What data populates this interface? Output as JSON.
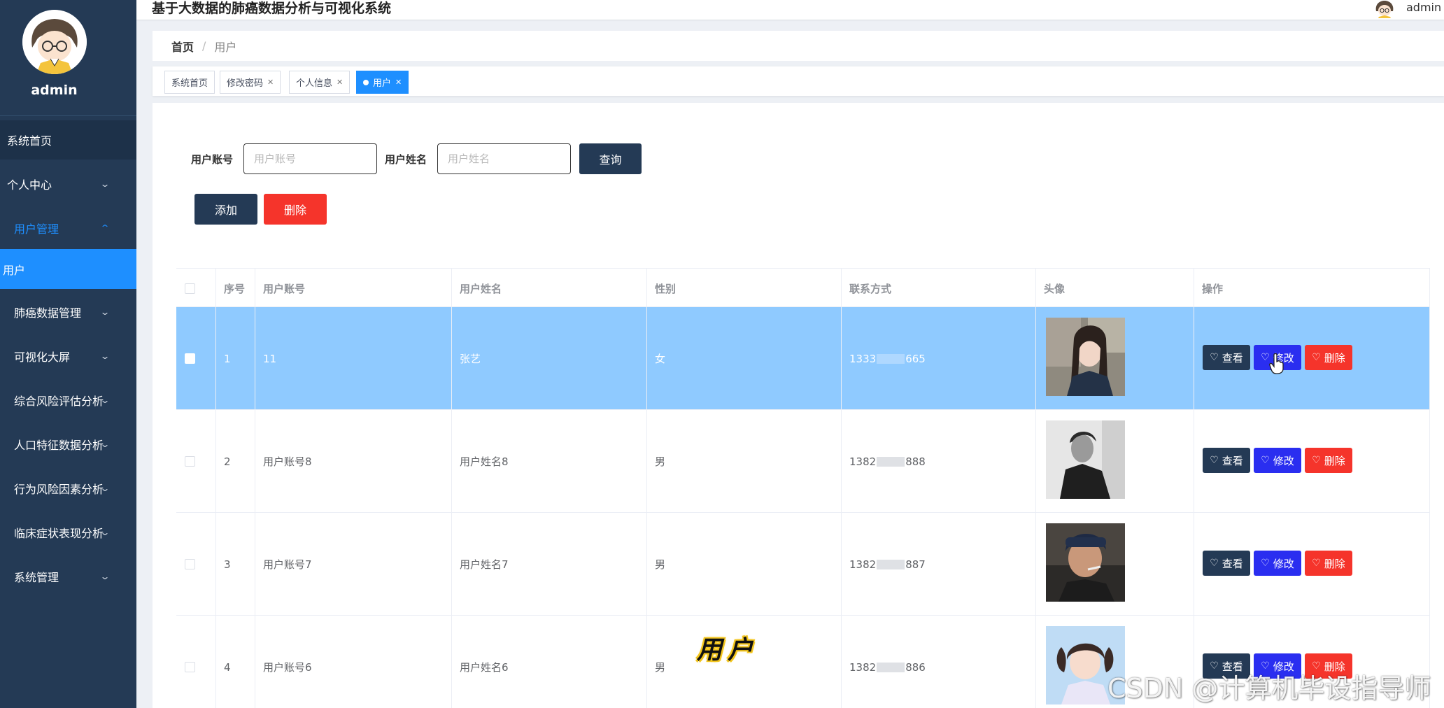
{
  "app": {
    "title": "基于大数据的肺癌数据分析与可视化系统",
    "user": "admin"
  },
  "sidebar": {
    "username": "admin",
    "items": [
      {
        "label": "系统首页",
        "state": "home"
      },
      {
        "label": "个人中心",
        "chevron": "down"
      },
      {
        "label": "用户管理",
        "chevron": "up",
        "state": "open"
      },
      {
        "label": "用户",
        "state": "active"
      },
      {
        "label": "肺癌数据管理",
        "chevron": "down"
      },
      {
        "label": "可视化大屏",
        "chevron": "down"
      },
      {
        "label": "综合风险评估分析",
        "chevron": "down"
      },
      {
        "label": "人口特征数据分析",
        "chevron": "down"
      },
      {
        "label": "行为风险因素分析",
        "chevron": "down"
      },
      {
        "label": "临床症状表现分析",
        "chevron": "down"
      },
      {
        "label": "系统管理",
        "chevron": "down"
      }
    ]
  },
  "breadcrumb": {
    "home": "首页",
    "separator": "/",
    "current": "用户"
  },
  "tags": [
    {
      "label": "系统首页",
      "closable": false
    },
    {
      "label": "修改密码",
      "closable": true
    },
    {
      "label": "个人信息",
      "closable": true
    },
    {
      "label": "用户",
      "closable": true,
      "active": true
    }
  ],
  "search": {
    "account_label": "用户账号",
    "account_placeholder": "用户账号",
    "name_label": "用户姓名",
    "name_placeholder": "用户姓名",
    "query_button": "查询"
  },
  "actions": {
    "add": "添加",
    "delete": "删除"
  },
  "table": {
    "columns": [
      "序号",
      "用户账号",
      "用户姓名",
      "性别",
      "联系方式",
      "头像",
      "操作"
    ],
    "rows": [
      {
        "index": "1",
        "account": "11",
        "name": "张艺",
        "gender": "女",
        "phone_prefix": "1333",
        "phone_suffix": "665",
        "selected": true
      },
      {
        "index": "2",
        "account": "用户账号8",
        "name": "用户姓名8",
        "gender": "男",
        "phone_prefix": "1382",
        "phone_suffix": "888"
      },
      {
        "index": "3",
        "account": "用户账号7",
        "name": "用户姓名7",
        "gender": "男",
        "phone_prefix": "1382",
        "phone_suffix": "887"
      },
      {
        "index": "4",
        "account": "用户账号6",
        "name": "用户姓名6",
        "gender": "男",
        "phone_prefix": "1382",
        "phone_suffix": "886"
      }
    ],
    "row_actions": {
      "view": "查看",
      "edit": "修改",
      "delete": "删除"
    }
  },
  "overlay": {
    "caption": "用户",
    "watermark": "CSDN @计算机毕设指导师"
  },
  "colors": {
    "sidebar": "#243a55",
    "accent": "#1e8fff",
    "selected_row": "#8fcaff",
    "danger": "#f5342b",
    "edit": "#2a2ef0"
  }
}
